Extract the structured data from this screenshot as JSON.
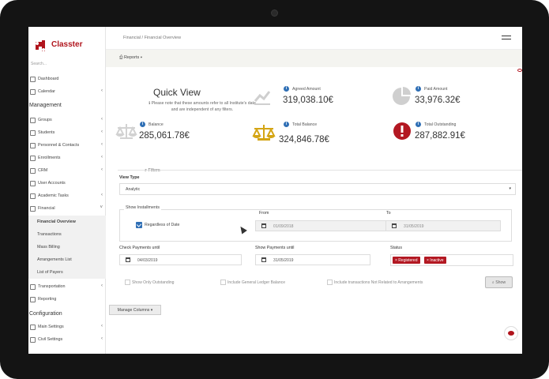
{
  "app": {
    "brand": "Classter",
    "search": "Search...",
    "breadcrumb": "Financial / Financial Overview",
    "reports": "Reports ▾"
  },
  "sidebar": {
    "management_heading": "Management",
    "configuration_heading": "Configuration",
    "items": [
      {
        "label": "Dashboard"
      },
      {
        "label": "Calendar"
      },
      {
        "label": "Groups"
      },
      {
        "label": "Students"
      },
      {
        "label": "Personnel & Contacts"
      },
      {
        "label": "Enrollments"
      },
      {
        "label": "CRM"
      },
      {
        "label": "User Accounts"
      },
      {
        "label": "Academic Tasks"
      },
      {
        "label": "Financial"
      },
      {
        "label": "Financial Overview"
      },
      {
        "label": "Transactions"
      },
      {
        "label": "Mass Billing"
      },
      {
        "label": "Arrangements List"
      },
      {
        "label": "List of Payers"
      },
      {
        "label": "Transportation"
      },
      {
        "label": "Reporting"
      },
      {
        "label": "Main Settings"
      },
      {
        "label": "Civil Settings"
      }
    ]
  },
  "quick_view": {
    "title": "Quick View",
    "note": "Please note that these amounts refer to all Institute's data and are independent of any filters.",
    "metrics": {
      "agreed": {
        "label": "Agreed Amount",
        "value": "319,038.10€"
      },
      "paid": {
        "label": "Paid Amount",
        "value": "33,976.32€"
      },
      "balance": {
        "label": "Balance",
        "value": "285,061.78€"
      },
      "total_balance": {
        "label": "Total Balance",
        "value": "324,846.78€"
      },
      "total_outstanding": {
        "label": "Total Outstanding",
        "value": "287,882.91€"
      }
    }
  },
  "filters": {
    "title": "Filters",
    "view_type_label": "View Type",
    "view_type_value": "Analytic",
    "installments_legend": "Show Installments",
    "regardless_label": "Regardless of Date",
    "from_label": "From",
    "from_value": "01/09/2018",
    "to_label": "To",
    "to_value": "31/05/2019",
    "check_payments_label": "Check Payments until",
    "check_payments_value": "04/03/2019",
    "show_payments_label": "Show Payments until",
    "show_payments_value": "31/05/2019",
    "status_label": "Status",
    "status_tags": [
      "× Registered",
      "× Inactive"
    ],
    "only_outstanding": "Show Only Outstanding",
    "include_general_ledger": "Include General Ledger Balance",
    "include_transactions": "Include transactions Not Related to Arrangements",
    "show_button": "Show"
  },
  "manage_columns": "Manage Columns ▾",
  "colors": {
    "brand": "#b0141c",
    "info": "#2f6fb5",
    "gold": "#d4a514",
    "red": "#b31822",
    "grey_icon": "#d2d2d2"
  }
}
